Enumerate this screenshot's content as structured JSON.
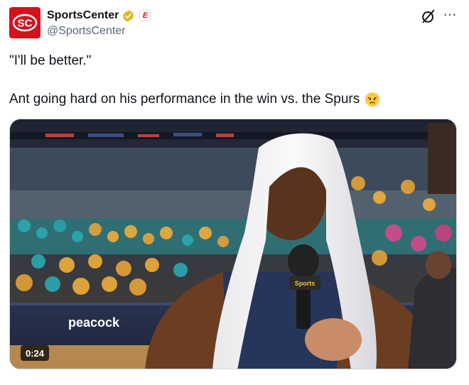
{
  "account": {
    "display_name": "SportsCenter",
    "handle": "@SportsCenter",
    "avatar_text": "SC",
    "affiliate_badge_text": "E",
    "brand_color": "#d4121b",
    "verified_color": "#e2b719"
  },
  "post": {
    "line1": "\"I'll be better.\"",
    "line2": "Ant going hard on his performance in the win vs. the Spurs",
    "emoji": "face-with-steam-from-nose"
  },
  "media": {
    "duration": "0:24",
    "court_sign_text": "peacock",
    "mic_text": "Sports"
  },
  "icons": {
    "grok": "grok-icon",
    "more": "more-icon"
  }
}
